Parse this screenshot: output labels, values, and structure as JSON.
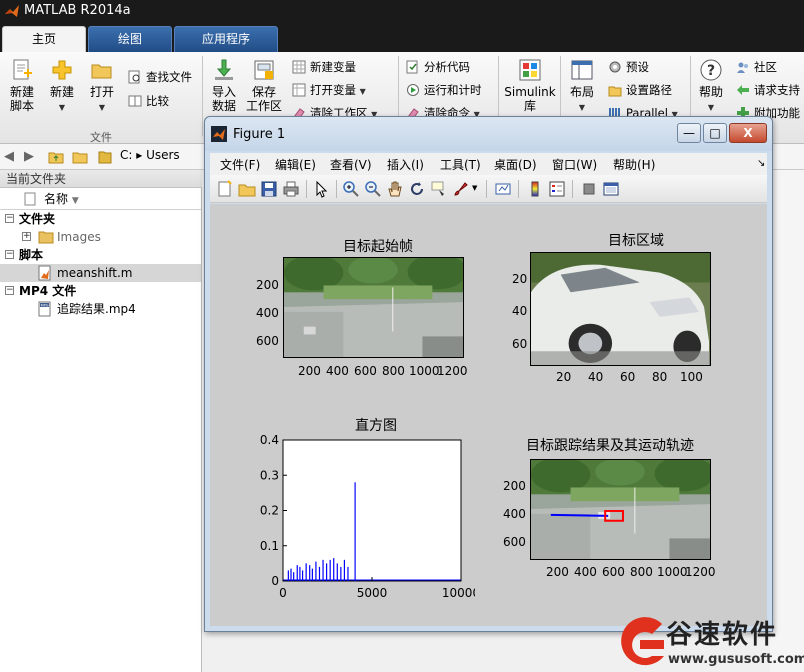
{
  "app": {
    "title": "MATLAB R2014a"
  },
  "tabs": [
    {
      "label": "主页",
      "active": true
    },
    {
      "label": "绘图",
      "active": false
    },
    {
      "label": "应用程序",
      "active": false
    }
  ],
  "ribbon": {
    "new_script": "新建\n脚本",
    "new": "新建",
    "open": "打开",
    "find_files": "查找文件",
    "compare": "比较",
    "file_group": "文件",
    "import_data": "导入\n数据",
    "save_workspace": "保存\n工作区",
    "new_variable": "新建变量",
    "open_variable": "打开变量",
    "clear_workspace": "清除工作区",
    "analyze_code": "分析代码",
    "run_and_time": "运行和计时",
    "clear_commands": "清除命令",
    "simulink": "Simulink\n库",
    "layout": "布局",
    "preferences": "预设",
    "set_path": "设置路径",
    "parallel": "Parallel",
    "help": "帮助",
    "community": "社区",
    "request_support": "请求支持",
    "add_ons": "附加功能"
  },
  "addressbar": {
    "path": "C: ▸ Users"
  },
  "current_folder": {
    "label": "当前文件夹",
    "column_name": "名称",
    "sections": [
      {
        "label": "文件夹",
        "items": [
          {
            "label": "Images",
            "kind": "folder"
          }
        ]
      },
      {
        "label": "脚本",
        "items": [
          {
            "label": "meanshift.m",
            "kind": "m-file",
            "selected": true
          }
        ]
      },
      {
        "label": "MP4 文件",
        "items": [
          {
            "label": "追踪结果.mp4",
            "kind": "mp4"
          }
        ]
      }
    ]
  },
  "figure": {
    "title": "Figure 1",
    "menu": [
      "文件(F)",
      "编辑(E)",
      "查看(V)",
      "插入(I)",
      "工具(T)",
      "桌面(D)",
      "窗口(W)",
      "帮助(H)"
    ],
    "window_buttons": {
      "minimize": "—",
      "maximize": "□",
      "close": "X"
    },
    "plots": {
      "p1": {
        "title": "目标起始帧",
        "yticks": [
          "200",
          "400",
          "600"
        ],
        "xticks": [
          "200",
          "400",
          "600",
          "800",
          "1000",
          "1200"
        ]
      },
      "p2": {
        "title": "目标区域",
        "yticks": [
          "20",
          "40",
          "60"
        ],
        "xticks": [
          "20",
          "40",
          "60",
          "80",
          "100"
        ]
      },
      "p3": {
        "title": "直方图",
        "yticks": [
          "0.4",
          "0.3",
          "0.2",
          "0.1",
          "0"
        ],
        "xticks": [
          "0",
          "5000",
          "10000"
        ]
      },
      "p4": {
        "title": "目标跟踪结果及其运动轨迹",
        "yticks": [
          "200",
          "400",
          "600"
        ],
        "xticks": [
          "200",
          "400",
          "600",
          "800",
          "1000",
          "1200"
        ]
      }
    }
  },
  "chart_data": {
    "type": "bar",
    "title": "直方图",
    "xlabel": "",
    "ylabel": "",
    "xlim": [
      0,
      10000
    ],
    "ylim": [
      0,
      0.4
    ],
    "color": "#0000ff",
    "x": [
      300,
      450,
      600,
      800,
      950,
      1100,
      1300,
      1500,
      1650,
      1850,
      2050,
      2250,
      2450,
      2650,
      2850,
      3050,
      3250,
      3450,
      3650,
      4050
    ],
    "values": [
      0.03,
      0.035,
      0.025,
      0.045,
      0.04,
      0.03,
      0.05,
      0.045,
      0.035,
      0.055,
      0.04,
      0.06,
      0.05,
      0.06,
      0.065,
      0.05,
      0.04,
      0.06,
      0.04,
      0.28
    ]
  },
  "watermark": {
    "brand": "谷速软件",
    "url": "www.gususoft.com"
  },
  "colors": {
    "tab_blue": "#2f5f9d",
    "plot_line": "#0000ff",
    "track_box": "#ff0000",
    "watermark_red": "#e0301e"
  }
}
